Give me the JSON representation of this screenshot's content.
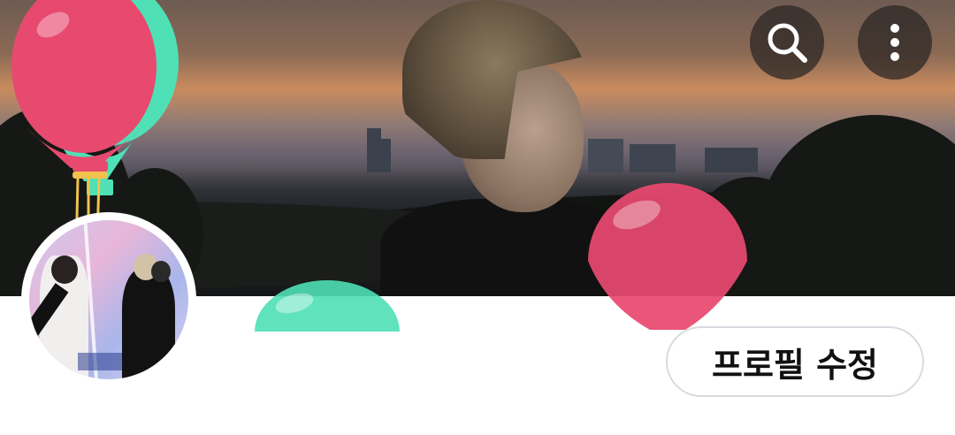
{
  "header": {
    "search_icon": "search-icon",
    "more_icon": "more-vertical-icon"
  },
  "profile": {
    "edit_button_label": "프로필 수정"
  },
  "colors": {
    "balloon_pink": "#e8496f",
    "balloon_mint": "#4fe0b6",
    "button_border": "#d7dbe0"
  }
}
